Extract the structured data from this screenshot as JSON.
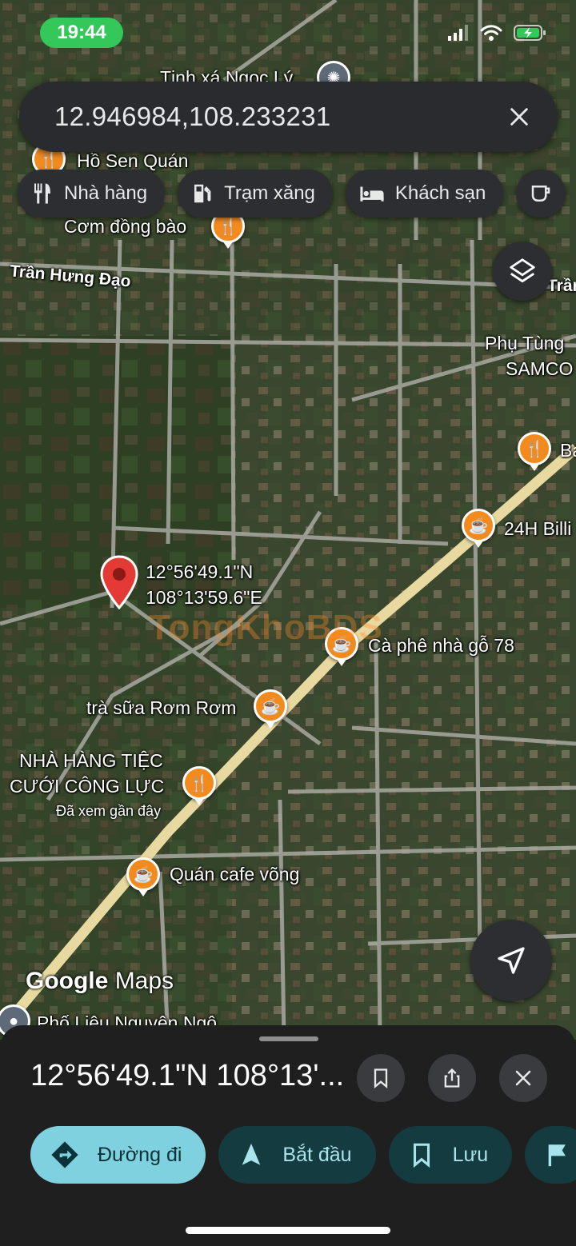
{
  "status_bar": {
    "time": "19:44"
  },
  "search": {
    "query": "12.946984,108.233231"
  },
  "chips": [
    {
      "label": "Nhà hàng",
      "icon": "restaurant-icon"
    },
    {
      "label": "Trạm xăng",
      "icon": "gas-station-icon"
    },
    {
      "label": "Khách sạn",
      "icon": "hotel-icon"
    }
  ],
  "map": {
    "road_labels": [
      {
        "text": "Trần Hưng Đạo"
      },
      {
        "text": "Trần"
      }
    ],
    "places": [
      {
        "name": "Tịnh xá Ngọc Lý",
        "icon": "temple-icon"
      },
      {
        "name": "Hồ Sen Quán",
        "icon": "restaurant-icon"
      },
      {
        "name": "Cơm đồng bào",
        "icon": "restaurant-icon"
      },
      {
        "name": "Phụ Tùng",
        "icon": ""
      },
      {
        "name": "SAMCO",
        "icon": ""
      },
      {
        "name": "Ba",
        "icon": "restaurant-icon"
      },
      {
        "name": "24H Billi",
        "icon": "cafe-icon"
      },
      {
        "name": "Cà phê nhà gỗ 78",
        "icon": "cafe-icon"
      },
      {
        "name": "trà sữa Rơm Rơm",
        "icon": "cafe-icon"
      },
      {
        "name": "NHÀ HÀNG TIỆC",
        "icon": "restaurant-icon"
      },
      {
        "name": "CƯỚI CÔNG LỰC",
        "icon": ""
      },
      {
        "name": "Quán cafe võng",
        "icon": "cafe-icon"
      },
      {
        "name": "Phố Liệu Nguyên Ngô",
        "icon": "place-icon"
      }
    ],
    "recently_viewed": "Đã xem gần đây",
    "dropped_pin": {
      "lat": "12°56'49.1\"N",
      "lng": "108°13'59.6\"E"
    },
    "watermark": "TongKhoBDS",
    "logo": {
      "brand": "Google",
      "product": "Maps"
    }
  },
  "sheet": {
    "title": "12°56'49.1\"N 108°13'...",
    "actions": [
      {
        "label": "Đường đi",
        "icon": "directions-icon"
      },
      {
        "label": "Bắt đầu",
        "icon": "navigation-arrow-icon"
      },
      {
        "label": "Lưu",
        "icon": "bookmark-icon"
      }
    ]
  },
  "colors": {
    "accent": "#7fd1df",
    "poi": "#f28a1e",
    "pin": "#e53935"
  }
}
